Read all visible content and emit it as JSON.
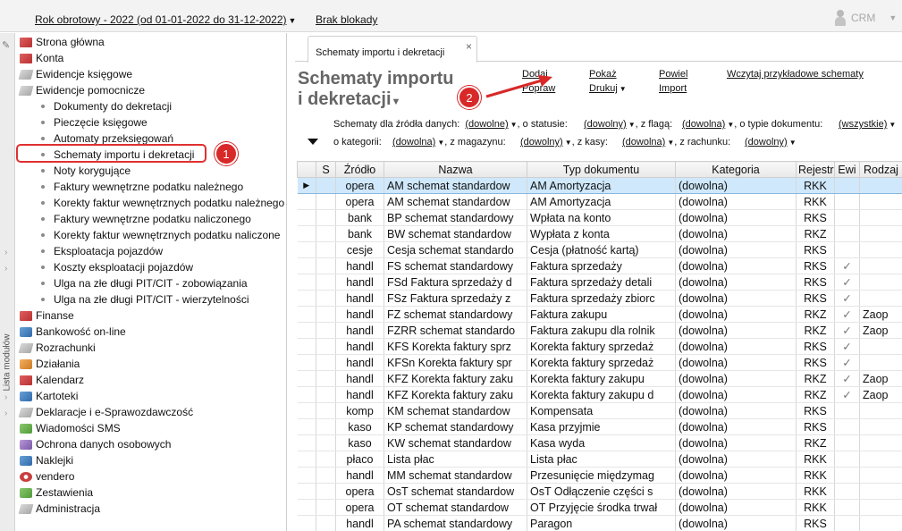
{
  "topbar": {
    "fiscal_year": "Rok obrotowy - 2022  (od 01-01-2022 do 31-12-2022)",
    "lock_status": "Brak blokady",
    "crm_label": "CRM"
  },
  "rail": {
    "label": "Lista modułów"
  },
  "sidebar": {
    "items": [
      {
        "label": "Strona główna",
        "icon": "home-icon"
      },
      {
        "label": "Konta",
        "icon": "accounts-icon"
      },
      {
        "label": "Ewidencje księgowe",
        "icon": "ledger-icon"
      },
      {
        "label": "Ewidencje pomocnicze",
        "icon": "auxiliary-ledger-icon"
      }
    ],
    "subitems": [
      "Dokumenty do dekretacji",
      "Pieczęcie księgowe",
      "Automaty przeksięgowań",
      "Schematy importu i dekretacji",
      "Noty korygujące",
      "Faktury wewnętrzne podatku należnego",
      "Korekty faktur wewnętrznych podatku należnego",
      "Faktury wewnętrzne podatku naliczonego",
      "Korekty faktur wewnętrznych podatku naliczone",
      "Eksploatacja pojazdów",
      "Koszty eksploatacji pojazdów",
      "Ulga na złe długi PIT/CIT - zobowiązania",
      "Ulga na złe długi PIT/CIT - wierzytelności"
    ],
    "modules": [
      {
        "label": "Finanse",
        "icon": "finance-icon"
      },
      {
        "label": "Bankowość on-line",
        "icon": "bank-icon"
      },
      {
        "label": "Rozrachunki",
        "icon": "settlements-icon"
      },
      {
        "label": "Działania",
        "icon": "actions-icon"
      },
      {
        "label": "Kalendarz",
        "icon": "calendar-icon"
      },
      {
        "label": "Kartoteki",
        "icon": "records-icon"
      },
      {
        "label": "Deklaracje i e-Sprawozdawczość",
        "icon": "declarations-icon"
      },
      {
        "label": "Wiadomości SMS",
        "icon": "sms-icon"
      },
      {
        "label": "Ochrona danych osobowych",
        "icon": "privacy-icon"
      },
      {
        "label": "Naklejki",
        "icon": "stickers-icon"
      },
      {
        "label": "vendero",
        "icon": "vendero-icon"
      },
      {
        "label": "Zestawienia",
        "icon": "reports-icon"
      },
      {
        "label": "Administracja",
        "icon": "admin-icon"
      }
    ]
  },
  "markers": {
    "one": "1",
    "two": "2"
  },
  "tab": {
    "title": "Schematy importu i dekretacji",
    "close": "×"
  },
  "page": {
    "title_line1": "Schematy importu",
    "title_line2": "i dekretacji"
  },
  "actions": {
    "add": "Dodaj",
    "edit": "Popraw",
    "show": "Pokaż",
    "print": "Drukuj",
    "duplicate": "Powiel",
    "import": "Import",
    "load_samples": "Wczytaj przykładowe schematy"
  },
  "filters": {
    "row1_label": "Schematy dla źródła danych:",
    "source": "(dowolne)",
    "status_label": ", o statusie:",
    "status": "(dowolny)",
    "flag_label": ", z flagą:",
    "flag": "(dowolna)",
    "doctype_label": ", o typie dokumentu:",
    "doctype": "(wszystkie)",
    "row2_label": "o kategorii:",
    "category": "(dowolna)",
    "warehouse_label": ", z magazynu:",
    "warehouse": "(dowolny)",
    "cash_label": ", z kasy:",
    "cash": "(dowolna)",
    "account_label": ", z rachunku:",
    "account": "(dowolny)"
  },
  "table": {
    "headers": [
      "",
      "S",
      "Źródło",
      "Nazwa",
      "Typ dokumentu",
      "Kategoria",
      "Rejestr",
      "Ewi",
      "Rodzaj"
    ],
    "rows": [
      [
        "opera",
        "AM schemat standardow",
        "AM Amortyzacja",
        "(dowolna)",
        "RKK",
        "",
        ""
      ],
      [
        "opera",
        "AM schemat standardow",
        "AM Amortyzacja",
        "(dowolna)",
        "RKK",
        "",
        ""
      ],
      [
        "bank",
        "BP schemat standardowy",
        "Wpłata na konto",
        "(dowolna)",
        "RKS",
        "",
        ""
      ],
      [
        "bank",
        "BW schemat standardow",
        "Wypłata z konta",
        "(dowolna)",
        "RKZ",
        "",
        ""
      ],
      [
        "cesje",
        "Cesja schemat standardo",
        "Cesja (płatność kartą)",
        "(dowolna)",
        "RKS",
        "",
        ""
      ],
      [
        "handl",
        "FS schemat standardowy",
        "Faktura sprzedaży",
        "(dowolna)",
        "RKS",
        "✓",
        ""
      ],
      [
        "handl",
        "FSd Faktura sprzedaży d",
        "Faktura sprzedaży detali",
        "(dowolna)",
        "RKS",
        "✓",
        ""
      ],
      [
        "handl",
        "FSz Faktura sprzedaży z",
        "Faktura sprzedaży zbiorc",
        "(dowolna)",
        "RKS",
        "✓",
        ""
      ],
      [
        "handl",
        "FZ schemat standardowy",
        "Faktura zakupu",
        "(dowolna)",
        "RKZ",
        "✓",
        "Zaop"
      ],
      [
        "handl",
        "FZRR schemat standardo",
        "Faktura zakupu dla rolnik",
        "(dowolna)",
        "RKZ",
        "✓",
        "Zaop"
      ],
      [
        "handl",
        "KFS Korekta faktury sprz",
        "Korekta faktury sprzedaż",
        "(dowolna)",
        "RKS",
        "✓",
        ""
      ],
      [
        "handl",
        "KFSn Korekta faktury spr",
        "Korekta faktury sprzedaż",
        "(dowolna)",
        "RKS",
        "✓",
        ""
      ],
      [
        "handl",
        "KFZ Korekta faktury zaku",
        "Korekta faktury zakupu",
        "(dowolna)",
        "RKZ",
        "✓",
        "Zaop"
      ],
      [
        "handl",
        "KFZ Korekta faktury zaku",
        "Korekta faktury zakupu d",
        "(dowolna)",
        "RKZ",
        "✓",
        "Zaop"
      ],
      [
        "komp",
        "KM schemat standardow",
        "Kompensata",
        "(dowolna)",
        "RKS",
        "",
        ""
      ],
      [
        "kaso",
        "KP schemat standardowy",
        "Kasa przyjmie",
        "(dowolna)",
        "RKS",
        "",
        ""
      ],
      [
        "kaso",
        "KW schemat standardow",
        "Kasa wyda",
        "(dowolna)",
        "RKZ",
        "",
        ""
      ],
      [
        "płaco",
        "Lista płac",
        "Lista płac",
        "(dowolna)",
        "RKK",
        "",
        ""
      ],
      [
        "handl",
        "MM schemat standardow",
        "Przesunięcie międzymag",
        "(dowolna)",
        "RKK",
        "",
        ""
      ],
      [
        "opera",
        "OsT schemat standardow",
        "OsT Odłączenie części s",
        "(dowolna)",
        "RKK",
        "",
        ""
      ],
      [
        "opera",
        "OT schemat standardow",
        "OT Przyjęcie środka trwał",
        "(dowolna)",
        "RKK",
        "",
        ""
      ],
      [
        "handl",
        "PA schemat standardowy",
        "Paragon",
        "(dowolna)",
        "RKS",
        "",
        ""
      ]
    ]
  },
  "colors": {
    "accent": "#d82828",
    "selection": "#cfe8fb"
  }
}
